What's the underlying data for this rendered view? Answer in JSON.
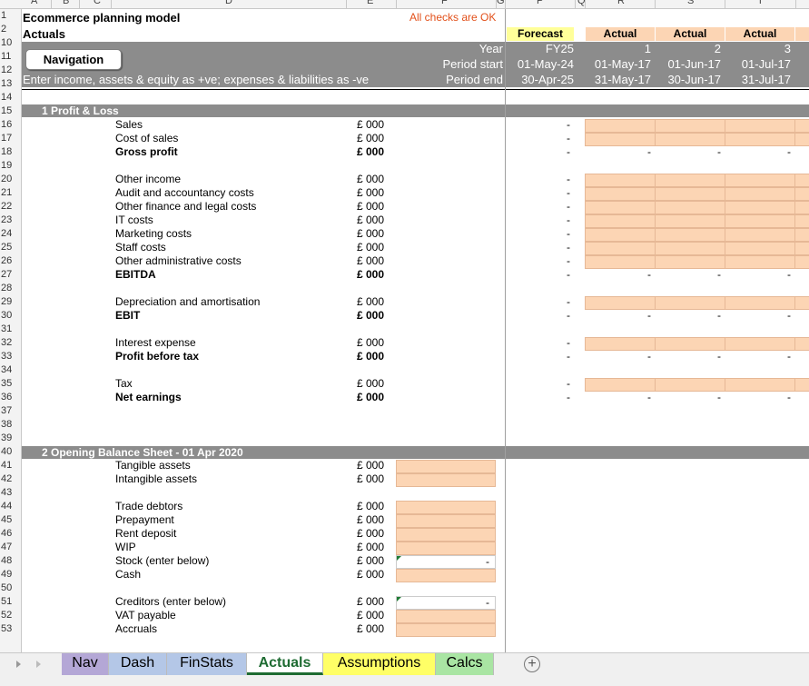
{
  "columns": [
    "A",
    "B",
    "C",
    "D",
    "E",
    "F",
    "G",
    "P",
    "Q",
    "R",
    "S",
    "T"
  ],
  "rows": [
    "1",
    "2",
    "10",
    "11",
    "12",
    "13",
    "14",
    "15",
    "16",
    "17",
    "18",
    "19",
    "20",
    "21",
    "22",
    "23",
    "24",
    "25",
    "26",
    "27",
    "28",
    "29",
    "30",
    "31",
    "32",
    "33",
    "34",
    "35",
    "36",
    "37",
    "38",
    "39",
    "40",
    "41",
    "42",
    "43",
    "44",
    "45",
    "46",
    "47",
    "48",
    "49",
    "50",
    "51",
    "52",
    "53"
  ],
  "header": {
    "title": "Ecommerce planning model",
    "sheet_label": "Actuals",
    "check_status": "All checks are OK",
    "instruction": "Enter income, assets & equity as +ve; expenses & liabilities as -ve",
    "nav_button": "Navigation",
    "year_label": "Year",
    "period_start_label": "Period start",
    "period_end_label": "Period end",
    "forecast": {
      "type": "Forecast",
      "year": "FY25",
      "start": "01-May-24",
      "end": "30-Apr-25"
    },
    "periods": [
      {
        "type": "Actual",
        "year": "1",
        "start": "01-May-17",
        "end": "31-May-17"
      },
      {
        "type": "Actual",
        "year": "2",
        "start": "01-Jun-17",
        "end": "30-Jun-17"
      },
      {
        "type": "Actual",
        "year": "3",
        "start": "01-Jul-17",
        "end": "31-Jul-17"
      }
    ]
  },
  "section1": {
    "title": "1 Profit & Loss",
    "unit": "£ 000",
    "dash": "-",
    "items": [
      {
        "label": "Sales",
        "bold": false
      },
      {
        "label": "Cost of sales",
        "bold": false
      },
      {
        "label": "Gross profit",
        "bold": true
      },
      {
        "label": "Other income",
        "bold": false
      },
      {
        "label": "Audit and accountancy costs",
        "bold": false
      },
      {
        "label": "Other finance and legal costs",
        "bold": false
      },
      {
        "label": "IT costs",
        "bold": false
      },
      {
        "label": "Marketing costs",
        "bold": false
      },
      {
        "label": "Staff costs",
        "bold": false
      },
      {
        "label": "Other administrative costs",
        "bold": false
      },
      {
        "label": "EBITDA",
        "bold": true
      },
      {
        "label": "Depreciation and amortisation",
        "bold": false
      },
      {
        "label": "EBIT",
        "bold": true
      },
      {
        "label": "Interest expense",
        "bold": false
      },
      {
        "label": "Profit before tax",
        "bold": true
      },
      {
        "label": "Tax",
        "bold": false
      },
      {
        "label": "Net earnings",
        "bold": true
      }
    ]
  },
  "section2": {
    "title": "2 Opening Balance Sheet - 01 Apr 2020",
    "unit": "£ 000",
    "dash": "-",
    "items": [
      {
        "label": "Tangible assets"
      },
      {
        "label": "Intangible assets"
      },
      {
        "label": "Trade debtors"
      },
      {
        "label": "Prepayment"
      },
      {
        "label": "Rent deposit"
      },
      {
        "label": "WIP"
      },
      {
        "label": "Stock (enter below)"
      },
      {
        "label": "Cash"
      },
      {
        "label": "Creditors (enter below)"
      },
      {
        "label": "VAT payable"
      },
      {
        "label": "Accruals"
      }
    ]
  },
  "tabs": [
    {
      "label": "Nav",
      "color": "#b4a7d6"
    },
    {
      "label": "Dash",
      "color": "#b4c7e7"
    },
    {
      "label": "FinStats",
      "color": "#b4c7e7"
    },
    {
      "label": "Actuals",
      "color": "#ffffff"
    },
    {
      "label": "Assumptions",
      "color": "#ffff66"
    },
    {
      "label": "Calcs",
      "color": "#a9e5a3"
    }
  ],
  "colors": {
    "input": "#fcd5b4",
    "band": "#8c8c8c",
    "forecast": "#ffff99",
    "actual": "#fcd5b4",
    "check_ok": "#e2501a"
  }
}
